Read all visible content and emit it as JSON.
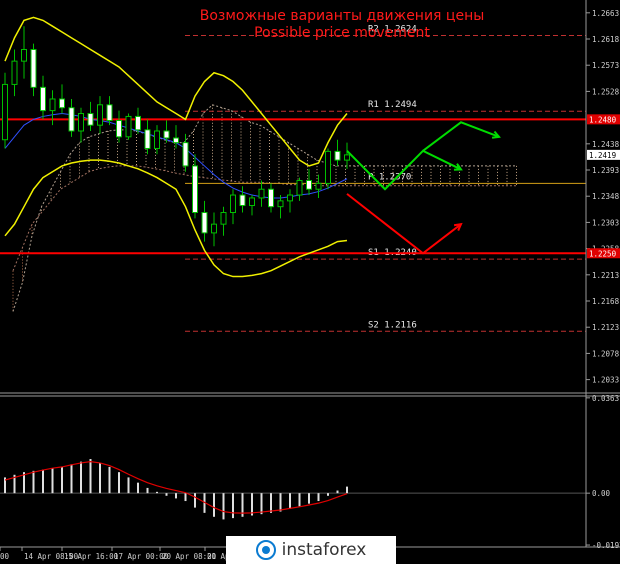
{
  "header": {
    "title_ru": "Возможные варианты движения цены",
    "title_en": "Possible price movement"
  },
  "chart_data": {
    "type": "candlestick",
    "price_axis": {
      "ticks": [
        "1.2663",
        "1.2618",
        "1.2573",
        "1.2528",
        "1.2438",
        "1.2393",
        "1.2348",
        "1.2303",
        "1.2258",
        "1.2213",
        "1.2168",
        "1.2123",
        "1.2078",
        "1.2033"
      ],
      "ylim": [
        1.201,
        1.2685
      ],
      "highlight_labels": [
        {
          "text": "1.2480",
          "value": 1.248,
          "bg": "#e00000",
          "fg": "#ffffff"
        },
        {
          "text": "1.2419",
          "value": 1.2419,
          "bg": "#ffffff",
          "fg": "#000000"
        },
        {
          "text": "1.2250",
          "value": 1.225,
          "bg": "#e00000",
          "fg": "#ffffff"
        }
      ]
    },
    "osc_axis": {
      "ticks": [
        "0.0363",
        "0.00",
        "-0.01975"
      ],
      "ylim": [
        -0.0205,
        0.037
      ]
    },
    "time_axis": {
      "labels": [
        "00",
        "14 Apr 08:00",
        "15 Apr 16:00",
        "17 Apr 00:00",
        "20 Apr 08:00",
        "21 Ap"
      ]
    },
    "pivot_levels": [
      {
        "name": "R2",
        "label": "R2  1.2624",
        "value": 1.2624,
        "style": "dashed",
        "color": "#c03030"
      },
      {
        "name": "R1",
        "label": "R1  1.2494",
        "value": 1.2494,
        "style": "dashed",
        "color": "#c03030"
      },
      {
        "name": "P",
        "label": "P   1.2370",
        "value": 1.237,
        "style": "solid",
        "color": "#d4a017"
      },
      {
        "name": "S1",
        "label": "S1  1.2240",
        "value": 1.224,
        "style": "dashed",
        "color": "#c03030"
      },
      {
        "name": "S2",
        "label": "S2  1.2116",
        "value": 1.2116,
        "style": "dashed",
        "color": "#c03030"
      }
    ],
    "support_resistance": [
      {
        "value": 1.248,
        "color": "#ff0000"
      },
      {
        "value": 1.225,
        "color": "#ff0000"
      }
    ],
    "candles_ohlc": [
      [
        1.2445,
        1.256,
        1.243,
        1.254
      ],
      [
        1.254,
        1.26,
        1.252,
        1.258
      ],
      [
        1.258,
        1.264,
        1.255,
        1.26
      ],
      [
        1.26,
        1.261,
        1.252,
        1.2535
      ],
      [
        1.2535,
        1.2555,
        1.248,
        1.2495
      ],
      [
        1.2495,
        1.253,
        1.247,
        1.2515
      ],
      [
        1.2515,
        1.254,
        1.249,
        1.25
      ],
      [
        1.25,
        1.2515,
        1.245,
        1.246
      ],
      [
        1.246,
        1.25,
        1.244,
        1.249
      ],
      [
        1.249,
        1.251,
        1.246,
        1.247
      ],
      [
        1.247,
        1.252,
        1.2455,
        1.2505
      ],
      [
        1.2505,
        1.252,
        1.247,
        1.2478
      ],
      [
        1.2478,
        1.2495,
        1.244,
        1.245
      ],
      [
        1.245,
        1.249,
        1.2445,
        1.2485
      ],
      [
        1.2485,
        1.25,
        1.2455,
        1.2462
      ],
      [
        1.2462,
        1.248,
        1.242,
        1.243
      ],
      [
        1.243,
        1.247,
        1.242,
        1.246
      ],
      [
        1.246,
        1.2478,
        1.244,
        1.2448
      ],
      [
        1.2448,
        1.247,
        1.243,
        1.244
      ],
      [
        1.244,
        1.2455,
        1.239,
        1.24
      ],
      [
        1.24,
        1.242,
        1.231,
        1.232
      ],
      [
        1.232,
        1.234,
        1.227,
        1.2285
      ],
      [
        1.2285,
        1.232,
        1.2262,
        1.23
      ],
      [
        1.23,
        1.233,
        1.228,
        1.232
      ],
      [
        1.232,
        1.236,
        1.23,
        1.235
      ],
      [
        1.235,
        1.2365,
        1.232,
        1.2332
      ],
      [
        1.2332,
        1.235,
        1.2315,
        1.2345
      ],
      [
        1.2345,
        1.2375,
        1.233,
        1.236
      ],
      [
        1.236,
        1.237,
        1.232,
        1.233
      ],
      [
        1.233,
        1.235,
        1.231,
        1.234
      ],
      [
        1.234,
        1.236,
        1.232,
        1.235
      ],
      [
        1.235,
        1.238,
        1.234,
        1.2375
      ],
      [
        1.2375,
        1.2395,
        1.235,
        1.236
      ],
      [
        1.236,
        1.2385,
        1.2345,
        1.237
      ],
      [
        1.237,
        1.243,
        1.236,
        1.2425
      ],
      [
        1.2425,
        1.2445,
        1.24,
        1.241
      ],
      [
        1.241,
        1.244,
        1.2395,
        1.2419
      ]
    ],
    "bollinger": {
      "upper": [
        1.258,
        1.262,
        1.265,
        1.2655,
        1.265,
        1.264,
        1.263,
        1.262,
        1.261,
        1.26,
        1.259,
        1.258,
        1.257,
        1.2555,
        1.254,
        1.2525,
        1.251,
        1.25,
        1.249,
        1.248,
        1.252,
        1.2545,
        1.256,
        1.2555,
        1.2545,
        1.253,
        1.251,
        1.249,
        1.247,
        1.245,
        1.243,
        1.241,
        1.24,
        1.2405,
        1.244,
        1.247,
        1.249
      ],
      "middle": [
        1.243,
        1.245,
        1.247,
        1.248,
        1.2485,
        1.2488,
        1.249,
        1.2488,
        1.2485,
        1.248,
        1.2478,
        1.2475,
        1.247,
        1.2465,
        1.246,
        1.2455,
        1.245,
        1.2445,
        1.244,
        1.243,
        1.2415,
        1.24,
        1.2385,
        1.2372,
        1.2362,
        1.2355,
        1.235,
        1.2347,
        1.2345,
        1.2345,
        1.2347,
        1.235,
        1.2352,
        1.2356,
        1.2362,
        1.237,
        1.2378
      ],
      "lower": [
        1.228,
        1.23,
        1.233,
        1.236,
        1.238,
        1.239,
        1.24,
        1.2405,
        1.2408,
        1.241,
        1.241,
        1.2408,
        1.2405,
        1.24,
        1.2395,
        1.2388,
        1.238,
        1.237,
        1.236,
        1.233,
        1.229,
        1.2255,
        1.223,
        1.2215,
        1.221,
        1.221,
        1.2212,
        1.2215,
        1.222,
        1.2228,
        1.2236,
        1.2244,
        1.225,
        1.2256,
        1.2262,
        1.227,
        1.2272
      ]
    },
    "cloud": {
      "span_a": [
        1.215,
        1.22,
        1.228,
        1.233,
        1.236,
        1.239,
        1.242,
        1.244,
        1.245,
        1.2455,
        1.246,
        1.2462,
        1.2462,
        1.246,
        1.2455,
        1.245,
        1.2445,
        1.244,
        1.244,
        1.246,
        1.249,
        1.2505,
        1.25,
        1.2495,
        1.2485,
        1.2475,
        1.247,
        1.246,
        1.245,
        1.244,
        1.243,
        1.242,
        1.241,
        1.2405,
        1.24,
        1.24,
        1.24,
        1.24,
        1.24,
        1.24,
        1.24,
        1.24,
        1.24,
        1.24,
        1.24,
        1.24,
        1.24,
        1.24,
        1.24,
        1.24,
        1.24,
        1.24,
        1.24,
        1.24
      ],
      "span_b": [
        1.222,
        1.226,
        1.23,
        1.232,
        1.234,
        1.236,
        1.237,
        1.238,
        1.239,
        1.2395,
        1.2398,
        1.24,
        1.24,
        1.24,
        1.2398,
        1.2395,
        1.2392,
        1.2388,
        1.2385,
        1.2382,
        1.238,
        1.2378,
        1.2376,
        1.2374,
        1.2372,
        1.2372,
        1.2372,
        1.237,
        1.237,
        1.2368,
        1.2368,
        1.2368,
        1.2366,
        1.2366,
        1.2366,
        1.2366,
        1.2366,
        1.2366,
        1.2366,
        1.2366,
        1.2366,
        1.2366,
        1.2366,
        1.2366,
        1.2366,
        1.2366,
        1.2366,
        1.2366,
        1.2366,
        1.2366,
        1.2366,
        1.2366,
        1.2366,
        1.2366
      ]
    },
    "macd": {
      "histogram": [
        0.006,
        0.007,
        0.008,
        0.0085,
        0.009,
        0.0095,
        0.01,
        0.011,
        0.012,
        0.013,
        0.0115,
        0.01,
        0.008,
        0.006,
        0.004,
        0.002,
        0.0005,
        -0.001,
        -0.002,
        -0.003,
        -0.0055,
        -0.0075,
        -0.009,
        -0.01,
        -0.0095,
        -0.009,
        -0.0085,
        -0.008,
        -0.0075,
        -0.007,
        -0.006,
        -0.005,
        -0.004,
        -0.003,
        -0.001,
        0.001,
        0.0025
      ],
      "signal": [
        0.005,
        0.006,
        0.007,
        0.008,
        0.0088,
        0.0095,
        0.01,
        0.0108,
        0.0115,
        0.012,
        0.0115,
        0.0105,
        0.009,
        0.0072,
        0.0055,
        0.004,
        0.0028,
        0.0018,
        0.001,
        0.0002,
        -0.0015,
        -0.0035,
        -0.0055,
        -0.007,
        -0.0075,
        -0.0076,
        -0.0075,
        -0.0072,
        -0.0068,
        -0.0064,
        -0.0058,
        -0.0052,
        -0.0045,
        -0.0038,
        -0.0028,
        -0.0015,
        -0.0002
      ]
    },
    "forecast_arrows": [
      {
        "color": "#00dd00",
        "points": [
          [
            1.2426,
            0
          ],
          [
            1.236,
            4
          ],
          [
            1.2426,
            8
          ],
          [
            1.2394,
            12
          ]
        ]
      },
      {
        "color": "#00dd00",
        "points": [
          [
            1.2426,
            8
          ],
          [
            1.2475,
            12
          ],
          [
            1.245,
            16
          ]
        ]
      },
      {
        "color": "#ff0000",
        "points": [
          [
            1.2352,
            0
          ],
          [
            1.225,
            8
          ],
          [
            1.23,
            12
          ]
        ]
      }
    ],
    "grid": false,
    "legend": "none"
  },
  "watermark": {
    "brand": "instaforex"
  }
}
